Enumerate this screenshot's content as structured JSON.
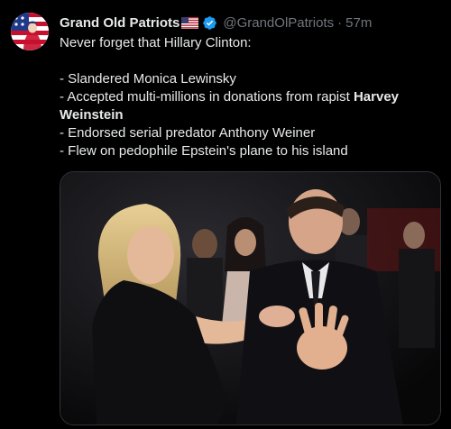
{
  "author": {
    "name": "Grand Old Patriots",
    "flag_icon": "us-flag-icon",
    "verified_icon": "verified-badge-icon",
    "handle": "@GrandOlPatriots",
    "separator": "·",
    "time": "57m"
  },
  "tweet": {
    "intro": "Never forget that Hillary Clinton:",
    "line1": "- Slandered Monica Lewinsky",
    "line2_prefix": "- Accepted multi-millions in donations from rapist ",
    "line2_bold": "Harvey Weinstein",
    "line3": "- Endorsed serial predator Anthony Weiner",
    "line4": "- Flew on pedophile Epstein's plane to his island"
  },
  "colors": {
    "background": "#000000",
    "text": "#e7e9ea",
    "muted": "#71767b",
    "verified": "#1d9bf0"
  }
}
